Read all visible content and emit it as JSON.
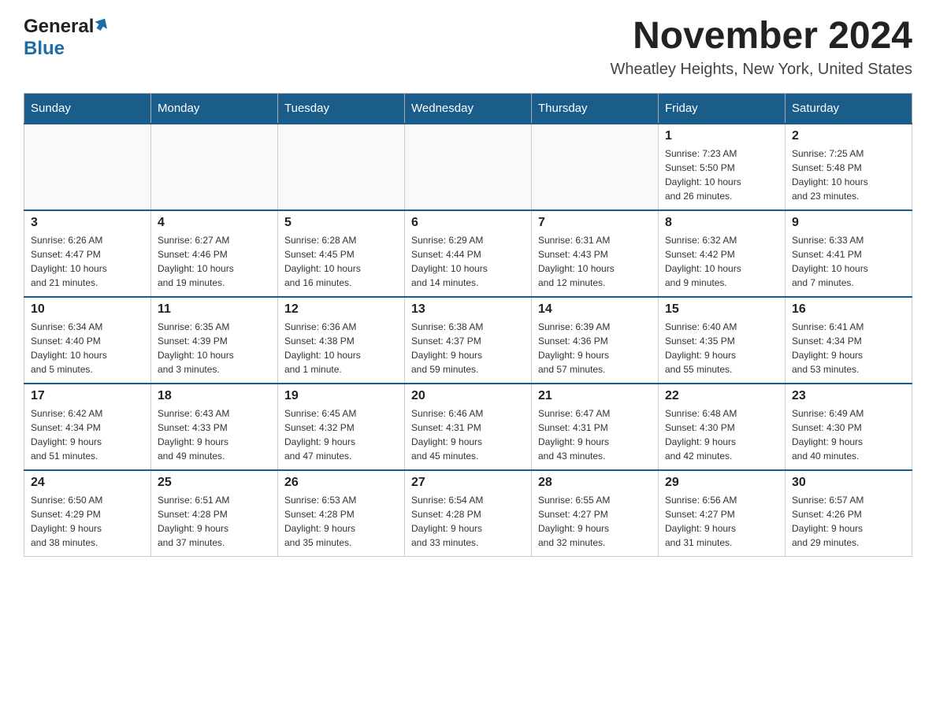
{
  "header": {
    "logo_general": "General",
    "logo_blue": "Blue",
    "month_title": "November 2024",
    "location": "Wheatley Heights, New York, United States"
  },
  "calendar": {
    "days_of_week": [
      "Sunday",
      "Monday",
      "Tuesday",
      "Wednesday",
      "Thursday",
      "Friday",
      "Saturday"
    ],
    "weeks": [
      {
        "days": [
          {
            "number": "",
            "info": ""
          },
          {
            "number": "",
            "info": ""
          },
          {
            "number": "",
            "info": ""
          },
          {
            "number": "",
            "info": ""
          },
          {
            "number": "",
            "info": ""
          },
          {
            "number": "1",
            "info": "Sunrise: 7:23 AM\nSunset: 5:50 PM\nDaylight: 10 hours\nand 26 minutes."
          },
          {
            "number": "2",
            "info": "Sunrise: 7:25 AM\nSunset: 5:48 PM\nDaylight: 10 hours\nand 23 minutes."
          }
        ]
      },
      {
        "days": [
          {
            "number": "3",
            "info": "Sunrise: 6:26 AM\nSunset: 4:47 PM\nDaylight: 10 hours\nand 21 minutes."
          },
          {
            "number": "4",
            "info": "Sunrise: 6:27 AM\nSunset: 4:46 PM\nDaylight: 10 hours\nand 19 minutes."
          },
          {
            "number": "5",
            "info": "Sunrise: 6:28 AM\nSunset: 4:45 PM\nDaylight: 10 hours\nand 16 minutes."
          },
          {
            "number": "6",
            "info": "Sunrise: 6:29 AM\nSunset: 4:44 PM\nDaylight: 10 hours\nand 14 minutes."
          },
          {
            "number": "7",
            "info": "Sunrise: 6:31 AM\nSunset: 4:43 PM\nDaylight: 10 hours\nand 12 minutes."
          },
          {
            "number": "8",
            "info": "Sunrise: 6:32 AM\nSunset: 4:42 PM\nDaylight: 10 hours\nand 9 minutes."
          },
          {
            "number": "9",
            "info": "Sunrise: 6:33 AM\nSunset: 4:41 PM\nDaylight: 10 hours\nand 7 minutes."
          }
        ]
      },
      {
        "days": [
          {
            "number": "10",
            "info": "Sunrise: 6:34 AM\nSunset: 4:40 PM\nDaylight: 10 hours\nand 5 minutes."
          },
          {
            "number": "11",
            "info": "Sunrise: 6:35 AM\nSunset: 4:39 PM\nDaylight: 10 hours\nand 3 minutes."
          },
          {
            "number": "12",
            "info": "Sunrise: 6:36 AM\nSunset: 4:38 PM\nDaylight: 10 hours\nand 1 minute."
          },
          {
            "number": "13",
            "info": "Sunrise: 6:38 AM\nSunset: 4:37 PM\nDaylight: 9 hours\nand 59 minutes."
          },
          {
            "number": "14",
            "info": "Sunrise: 6:39 AM\nSunset: 4:36 PM\nDaylight: 9 hours\nand 57 minutes."
          },
          {
            "number": "15",
            "info": "Sunrise: 6:40 AM\nSunset: 4:35 PM\nDaylight: 9 hours\nand 55 minutes."
          },
          {
            "number": "16",
            "info": "Sunrise: 6:41 AM\nSunset: 4:34 PM\nDaylight: 9 hours\nand 53 minutes."
          }
        ]
      },
      {
        "days": [
          {
            "number": "17",
            "info": "Sunrise: 6:42 AM\nSunset: 4:34 PM\nDaylight: 9 hours\nand 51 minutes."
          },
          {
            "number": "18",
            "info": "Sunrise: 6:43 AM\nSunset: 4:33 PM\nDaylight: 9 hours\nand 49 minutes."
          },
          {
            "number": "19",
            "info": "Sunrise: 6:45 AM\nSunset: 4:32 PM\nDaylight: 9 hours\nand 47 minutes."
          },
          {
            "number": "20",
            "info": "Sunrise: 6:46 AM\nSunset: 4:31 PM\nDaylight: 9 hours\nand 45 minutes."
          },
          {
            "number": "21",
            "info": "Sunrise: 6:47 AM\nSunset: 4:31 PM\nDaylight: 9 hours\nand 43 minutes."
          },
          {
            "number": "22",
            "info": "Sunrise: 6:48 AM\nSunset: 4:30 PM\nDaylight: 9 hours\nand 42 minutes."
          },
          {
            "number": "23",
            "info": "Sunrise: 6:49 AM\nSunset: 4:30 PM\nDaylight: 9 hours\nand 40 minutes."
          }
        ]
      },
      {
        "days": [
          {
            "number": "24",
            "info": "Sunrise: 6:50 AM\nSunset: 4:29 PM\nDaylight: 9 hours\nand 38 minutes."
          },
          {
            "number": "25",
            "info": "Sunrise: 6:51 AM\nSunset: 4:28 PM\nDaylight: 9 hours\nand 37 minutes."
          },
          {
            "number": "26",
            "info": "Sunrise: 6:53 AM\nSunset: 4:28 PM\nDaylight: 9 hours\nand 35 minutes."
          },
          {
            "number": "27",
            "info": "Sunrise: 6:54 AM\nSunset: 4:28 PM\nDaylight: 9 hours\nand 33 minutes."
          },
          {
            "number": "28",
            "info": "Sunrise: 6:55 AM\nSunset: 4:27 PM\nDaylight: 9 hours\nand 32 minutes."
          },
          {
            "number": "29",
            "info": "Sunrise: 6:56 AM\nSunset: 4:27 PM\nDaylight: 9 hours\nand 31 minutes."
          },
          {
            "number": "30",
            "info": "Sunrise: 6:57 AM\nSunset: 4:26 PM\nDaylight: 9 hours\nand 29 minutes."
          }
        ]
      }
    ]
  }
}
